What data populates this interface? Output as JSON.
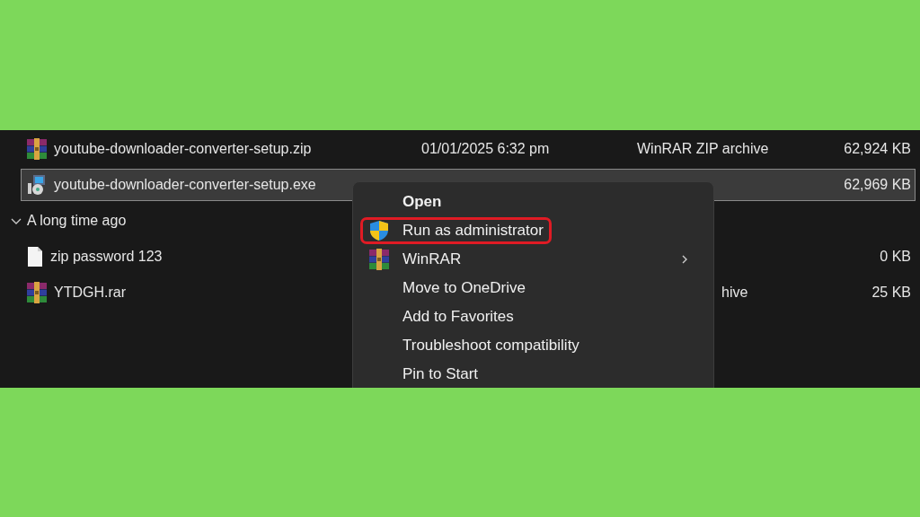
{
  "files": [
    {
      "kind": "archive",
      "name": "youtube-downloader-converter-setup.zip",
      "date": "01/01/2025 6:32 pm",
      "type": "WinRAR ZIP archive",
      "size": "62,924 KB",
      "selected": false
    },
    {
      "kind": "installer",
      "name": "youtube-downloader-converter-setup.exe",
      "size": "62,969 KB",
      "selected": true
    },
    {
      "kind": "group",
      "label": "A long time ago",
      "expanded": true
    },
    {
      "kind": "document",
      "name": "zip password 123",
      "size": "0 KB",
      "selected": false
    },
    {
      "kind": "archive",
      "name": "YTDGH.rar",
      "type": "hive",
      "size": "25 KB",
      "selected": false
    }
  ],
  "context_menu": {
    "items": [
      {
        "kind": "plain",
        "label": "Open",
        "bold": true,
        "highlighted": false,
        "submenu": false
      },
      {
        "kind": "shield",
        "label": "Run as administrator",
        "bold": false,
        "highlighted": true,
        "submenu": false
      },
      {
        "kind": "archive",
        "label": "WinRAR",
        "bold": false,
        "highlighted": false,
        "submenu": true
      },
      {
        "kind": "plain",
        "label": "Move to OneDrive",
        "bold": false,
        "highlighted": false,
        "submenu": false
      },
      {
        "kind": "plain",
        "label": "Add to Favorites",
        "bold": false,
        "highlighted": false,
        "submenu": false
      },
      {
        "kind": "plain",
        "label": "Troubleshoot compatibility",
        "bold": false,
        "highlighted": false,
        "submenu": false
      },
      {
        "kind": "plain",
        "label": "Pin to Start",
        "bold": false,
        "highlighted": false,
        "submenu": false
      }
    ]
  }
}
